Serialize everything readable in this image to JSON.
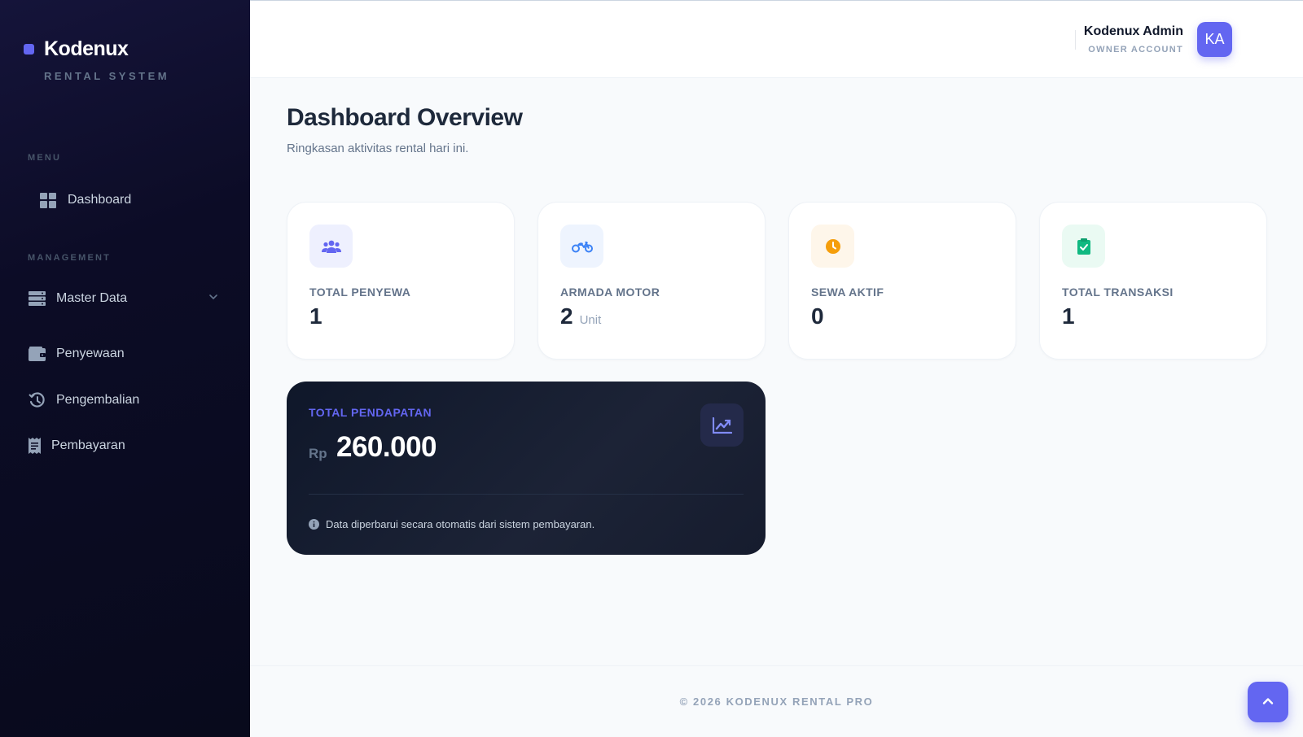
{
  "brand": {
    "name": "Kodenux",
    "subtitle": "RENTAL SYSTEM"
  },
  "sidebar": {
    "menu_label": "MENU",
    "management_label": "MANAGEMENT",
    "items": [
      {
        "label": "Dashboard",
        "icon": "grid-icon"
      },
      {
        "label": "Master Data",
        "icon": "database-icon",
        "has_submenu": true
      },
      {
        "label": "Penyewaan",
        "icon": "wallet-icon"
      },
      {
        "label": "Pengembalian",
        "icon": "history-icon"
      },
      {
        "label": "Pembayaran",
        "icon": "receipt-icon"
      }
    ]
  },
  "header": {
    "user_name": "Kodenux Admin",
    "user_role": "OWNER ACCOUNT",
    "avatar_initials": "KA"
  },
  "page": {
    "title": "Dashboard Overview",
    "subtitle": "Ringkasan aktivitas rental hari ini."
  },
  "stats": [
    {
      "label": "TOTAL PENYEWA",
      "value": "1",
      "unit": "",
      "icon": "users-icon",
      "accent": "#6366f1",
      "bg": "#eef0fe"
    },
    {
      "label": "ARMADA MOTOR",
      "value": "2",
      "unit": "Unit",
      "icon": "motorcycle-icon",
      "accent": "#3b82f6",
      "bg": "#eef4fe"
    },
    {
      "label": "SEWA AKTIF",
      "value": "0",
      "unit": "",
      "icon": "clock-icon",
      "accent": "#f59e0b",
      "bg": "#fef6ea"
    },
    {
      "label": "TOTAL TRANSAKSI",
      "value": "1",
      "unit": "",
      "icon": "clipboard-check-icon",
      "accent": "#10b981",
      "bg": "#eafaf3"
    }
  ],
  "revenue": {
    "label": "TOTAL PENDAPATAN",
    "currency": "Rp",
    "value": "260.000",
    "note": "Data diperbarui secara otomatis dari sistem pembayaran.",
    "icon": "chart-line-icon"
  },
  "footer": {
    "text": "© 2026 KODENUX RENTAL PRO"
  },
  "colors": {
    "accent": "#6366f1",
    "sidebar_bg": "#0c0c26",
    "revenue_bg": "#0f172a"
  }
}
